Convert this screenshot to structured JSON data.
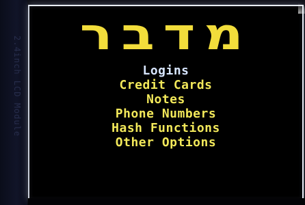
{
  "module": {
    "silkscreen_label": "2.4inch LCD Module"
  },
  "screen": {
    "title": "מדבר",
    "menu": {
      "selected_index": 0,
      "items": [
        {
          "label": "Logins"
        },
        {
          "label": "Credit Cards"
        },
        {
          "label": "Notes"
        },
        {
          "label": "Phone Numbers"
        },
        {
          "label": "Hash Functions"
        },
        {
          "label": "Other Options"
        }
      ]
    }
  },
  "colors": {
    "title": "#f2dd3b",
    "menu_item": "#f2e85a",
    "menu_item_selected": "#d8e6ff",
    "background": "#000000"
  }
}
